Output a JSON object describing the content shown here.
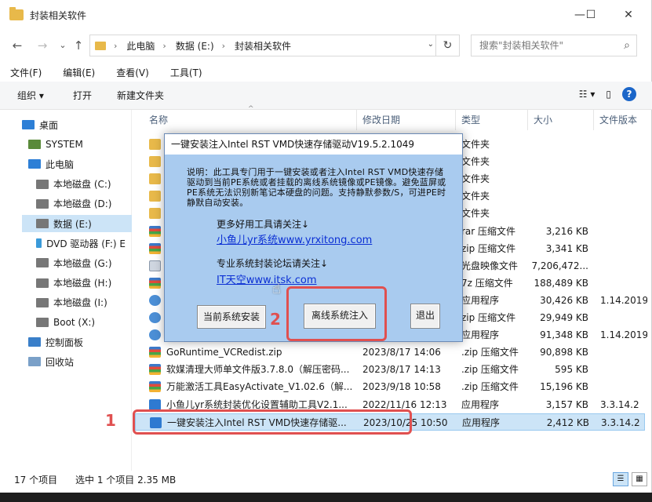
{
  "window": {
    "title": "封装相关软件",
    "controls": {
      "minimize": "—",
      "maximize": "☐",
      "close": "✕"
    }
  },
  "nav": {
    "back": "←",
    "forward": "→",
    "dropdown": "⌄",
    "up": "↑",
    "breadcrumb": [
      "此电脑",
      "数据 (E:)",
      "封装相关软件"
    ],
    "refresh": "↻",
    "search_placeholder": "搜索\"封装相关软件\"",
    "search_icon": "⌕"
  },
  "menu": [
    "文件(F)",
    "编辑(E)",
    "查看(V)",
    "工具(T)"
  ],
  "toolbar": {
    "organize": "组织 ▾",
    "open": "打开",
    "new_folder": "新建文件夹",
    "views": "☷ ▾",
    "pane": "▯",
    "help": "?"
  },
  "sidebar": {
    "items": [
      {
        "label": "桌面",
        "icon": "desktop-icon",
        "color": "#2d7fd6"
      },
      {
        "label": "SYSTEM",
        "icon": "user-icon",
        "color": "#5a8a3a"
      },
      {
        "label": "此电脑",
        "icon": "computer-icon",
        "color": "#2d7fd6"
      },
      {
        "label": "本地磁盘 (C:)",
        "icon": "drive-icon",
        "color": "#777777"
      },
      {
        "label": "本地磁盘 (D:)",
        "icon": "drive-icon",
        "color": "#777777"
      },
      {
        "label": "数据 (E:)",
        "icon": "drive-icon",
        "color": "#777777"
      },
      {
        "label": "DVD 驱动器 (F:) E",
        "icon": "dvd-icon",
        "color": "#3a9ad9"
      },
      {
        "label": "本地磁盘 (G:)",
        "icon": "drive-icon",
        "color": "#777777"
      },
      {
        "label": "本地磁盘 (H:)",
        "icon": "drive-icon",
        "color": "#777777"
      },
      {
        "label": "本地磁盘 (I:)",
        "icon": "drive-icon",
        "color": "#777777"
      },
      {
        "label": "Boot (X:)",
        "icon": "drive-icon",
        "color": "#777777"
      },
      {
        "label": "控制面板",
        "icon": "control-panel-icon",
        "color": "#3a7fc9"
      },
      {
        "label": "回收站",
        "icon": "recycle-bin-icon",
        "color": "#7aa0c8"
      }
    ]
  },
  "columns": {
    "name": "名称",
    "modified": "修改日期",
    "type": "类型",
    "size": "大小",
    "version": "文件版本"
  },
  "files": [
    {
      "name": "",
      "date": "",
      "type": "文件夹",
      "size": "",
      "version": "",
      "icon": "folder"
    },
    {
      "name": "",
      "date": "",
      "type": "文件夹",
      "size": "",
      "version": "",
      "icon": "folder"
    },
    {
      "name": "",
      "date": "",
      "type": "文件夹",
      "size": "",
      "version": "",
      "icon": "folder"
    },
    {
      "name": "",
      "date": "",
      "type": "文件夹",
      "size": "",
      "version": "",
      "icon": "folder"
    },
    {
      "name": "",
      "date": "",
      "type": "文件夹",
      "size": "",
      "version": "",
      "icon": "folder"
    },
    {
      "name": "",
      "date": "",
      "type": "rar 压缩文件",
      "size": "3,216 KB",
      "version": "",
      "icon": "zip"
    },
    {
      "name": "",
      "date": "",
      "type": "zip 压缩文件",
      "size": "3,341 KB",
      "version": "",
      "icon": "zip"
    },
    {
      "name": "",
      "date": "",
      "type": "光盘映像文件",
      "size": "7,206,472...",
      "version": "",
      "icon": "iso"
    },
    {
      "name": "",
      "date": "",
      "type": "7z 压缩文件",
      "size": "188,489 KB",
      "version": "",
      "icon": "zip"
    },
    {
      "name": "",
      "date": "",
      "type": "应用程序",
      "size": "30,426 KB",
      "version": "1.14.2019.",
      "icon": "gear"
    },
    {
      "name": "",
      "date": "",
      "type": "zip 压缩文件",
      "size": "29,949 KB",
      "version": "",
      "icon": "gear"
    },
    {
      "name": "",
      "date": "",
      "type": "应用程序",
      "size": "91,348 KB",
      "version": "1.14.2019.",
      "icon": "gear"
    },
    {
      "name": "GoRuntime_VCRedist.zip",
      "date": "2023/8/17 14:06",
      "type": ".zip 压缩文件",
      "size": "90,898 KB",
      "version": "",
      "icon": "zip"
    },
    {
      "name": "软媒清理大师单文件版3.7.8.0（解压密码...",
      "date": "2023/8/17 14:13",
      "type": ".zip 压缩文件",
      "size": "595 KB",
      "version": "",
      "icon": "zip"
    },
    {
      "name": "万能激活工具EasyActivate_V1.02.6（解...",
      "date": "2023/9/18 10:58",
      "type": ".zip 压缩文件",
      "size": "15,196 KB",
      "version": "",
      "icon": "zip"
    },
    {
      "name": "小鱼儿yr系统封装优化设置辅助工具V2.1...",
      "date": "2022/11/16 12:13",
      "type": "应用程序",
      "size": "3,157 KB",
      "version": "3.3.14.2",
      "icon": "exe"
    },
    {
      "name": "一键安装注入Intel RST VMD快速存储驱...",
      "date": "2023/10/25 10:50",
      "type": "应用程序",
      "size": "2,412 KB",
      "version": "3.3.14.2",
      "icon": "exe"
    }
  ],
  "status": {
    "count": "17 个项目",
    "selected": "选中 1 个项目  2.35 MB"
  },
  "dialog": {
    "title": "一键安装注入Intel RST VMD快速存储驱动V19.5.2.1049",
    "description": "说明：此工具专门用于一键安装或者注入Intel RST VMD快速存储驱动到当前PE系统或者挂载的离线系统镜像或PE镜像。避免蓝屏或PE系统无法识别新笔记本硬盘的问题。支持静默参数/S，可进PE时静默自动安装。",
    "more_tools_label": "更多好用工具请关注↓",
    "link1": "小鱼儿yr系统www.yrxitong.com",
    "forum_label": "专业系统封装论坛请关注↓",
    "link2": "IT天空www.itsk.com",
    "btn_current": "当前系统安装",
    "btn_offline": "离线系统注入",
    "btn_exit": "退出"
  },
  "annotations": {
    "marker1": "1",
    "marker2": "2",
    "color": "#e05050"
  }
}
